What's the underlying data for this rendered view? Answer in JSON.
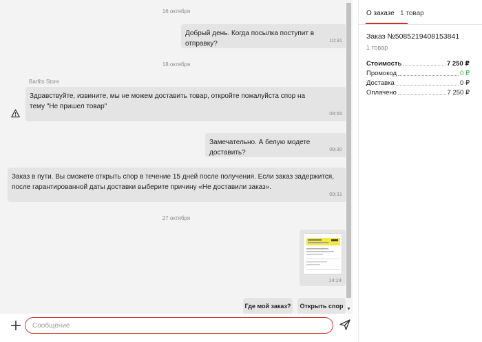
{
  "chat": {
    "dates": [
      "16 октября",
      "18 октября",
      "27 октября"
    ],
    "sender_name": "Barfits Store",
    "messages": [
      {
        "text": "Добрый день. Когда посылка поступит в отправку?",
        "time": "10:31"
      },
      {
        "text": "Здравствуйте, извините, мы не можем доставить товар, откройте пожалуйста спор на тему \"Не пришел товар\"",
        "time": "08:55"
      },
      {
        "text": "Замечательно. А белую модете доставить?",
        "time": "09:30"
      },
      {
        "text": "Заказ в пути. Вы сможете открыть спор в течение 15 дней после получения. Если заказ задержится, после гарантированной даты доставки выберите причину «Не доставили заказ».",
        "time": "09:31"
      },
      {
        "time": "14:24"
      }
    ],
    "quick_replies": [
      "Где мой заказ?",
      "Открыть спор"
    ],
    "input_placeholder": "Сообщение",
    "input_value": ""
  },
  "panel": {
    "tabs": [
      "О заказе",
      "1 товар"
    ],
    "active_tab": 0,
    "order_number": "Заказ №5085219408153841",
    "items_count": "1 товар",
    "summary": [
      {
        "label": "Стоимость",
        "value": "7 250 ₽"
      },
      {
        "label": "Промокод",
        "value": "0 ₽"
      },
      {
        "label": "Доставка",
        "value": "0 ₽"
      },
      {
        "label": "Оплачено",
        "value": "7 250 ₽"
      }
    ]
  },
  "colors": {
    "accent": "#c9302c",
    "input_border": "#d0342c",
    "promo_green": "#2fa84f",
    "bubble": "#e4e4e4",
    "chat_bg": "#f3f3f3"
  },
  "icons": {
    "warning": "warning-triangle-icon",
    "attach": "plus-icon",
    "send": "send-icon",
    "scroll_down": "chevron-down-icon"
  }
}
